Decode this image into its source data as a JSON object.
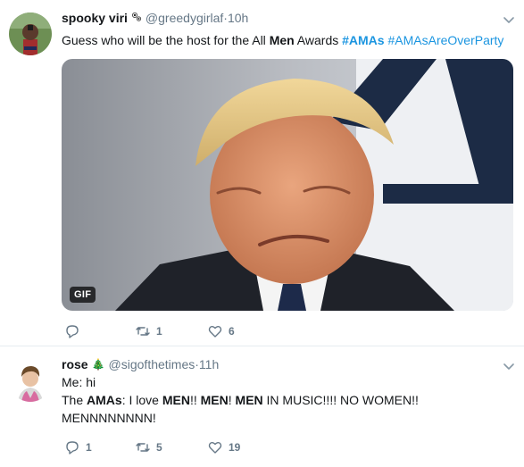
{
  "tweets": [
    {
      "name": "spooky viri",
      "handle": "@greedygirlaf",
      "time": "10h",
      "text_plain": "Guess who will be the host for the All ",
      "text_bold": "Men",
      "text_after": " Awards ",
      "hashtag1": "#AMAs",
      "hashtag2": "#AMAsAreOverParty",
      "media_badge": "GIF",
      "reply_count": "",
      "retweet_count": "1",
      "like_count": "6"
    },
    {
      "name": "rose",
      "emoji": "🎄",
      "handle": "@sigofthetimes",
      "time": "11h",
      "line1": "Me: hi",
      "l2_a": "The ",
      "l2_b": "AMAs",
      "l2_c": ": I love ",
      "l2_d": "MEN",
      "l2_e": "!! ",
      "l2_f": "MEN",
      "l2_g": "! ",
      "l2_h": "MEN",
      "l2_i": " IN MUSIC!!!! NO WOMEN!!",
      "line3": "MENNNNNNNN!",
      "reply_count": "1",
      "retweet_count": "5",
      "like_count": "19"
    }
  ],
  "sep": " · ",
  "colors": {
    "link": "#1b95e0",
    "muted": "#657786",
    "border": "#e6ecf0"
  }
}
